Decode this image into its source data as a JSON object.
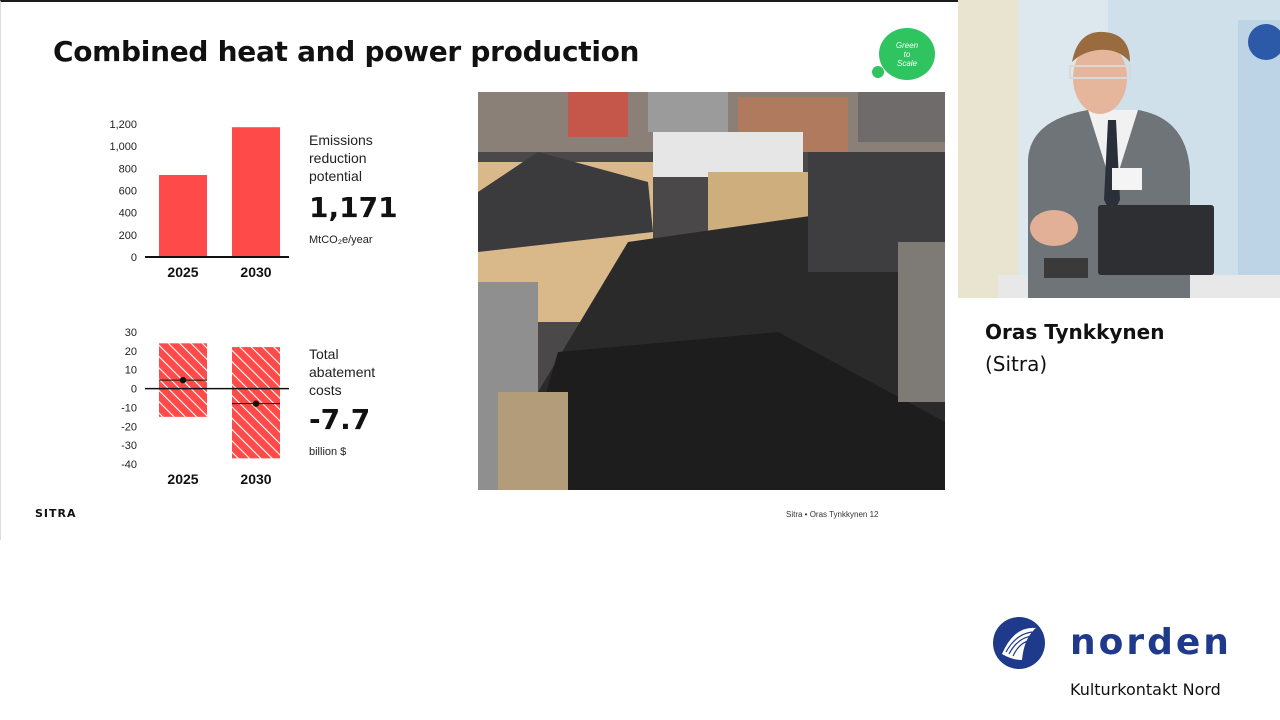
{
  "slide": {
    "title": "Combined heat and power production",
    "badge_lines": [
      "Green",
      "to",
      "Scale"
    ],
    "footer_note": "Sitra • Oras Tynkkynen  12",
    "logo_text": "SITRA"
  },
  "emissions": {
    "label_lines": [
      "Emissions",
      "reduction",
      "potential"
    ],
    "value": "1,171",
    "unit": "MtCO₂e/year"
  },
  "costs": {
    "label_lines": [
      "Total",
      "abatement",
      "costs"
    ],
    "value": "-7.7",
    "unit": "billion $"
  },
  "chart_data": [
    {
      "type": "bar",
      "categories": [
        "2025",
        "2030"
      ],
      "values": [
        740,
        1171
      ],
      "ylim": [
        0,
        1200
      ],
      "yticks": [
        "0",
        "200",
        "400",
        "600",
        "800",
        "1,000",
        "1,200"
      ],
      "ytick_values": [
        0,
        200,
        400,
        600,
        800,
        1000,
        1200
      ],
      "color": "#ff4a4a",
      "grid": false
    },
    {
      "type": "bar",
      "categories": [
        "2025",
        "2030"
      ],
      "ranges": [
        [
          -15,
          24
        ],
        [
          -37,
          22
        ]
      ],
      "points": [
        4.5,
        -8
      ],
      "ylim": [
        -40,
        30
      ],
      "yticks": [
        "-40",
        "-30",
        "-20",
        "-10",
        "0",
        "10",
        "20",
        "30"
      ],
      "ytick_values": [
        -40,
        -30,
        -20,
        -10,
        0,
        10,
        20,
        30
      ],
      "color": "#ff4a4a",
      "grid": false
    }
  ],
  "speaker": {
    "name": "Oras Tynkkynen",
    "org": "(Sitra)"
  },
  "branding": {
    "word": "norden",
    "sub": "Kulturkontakt Nord",
    "brand_color": "#1f3a8a"
  }
}
